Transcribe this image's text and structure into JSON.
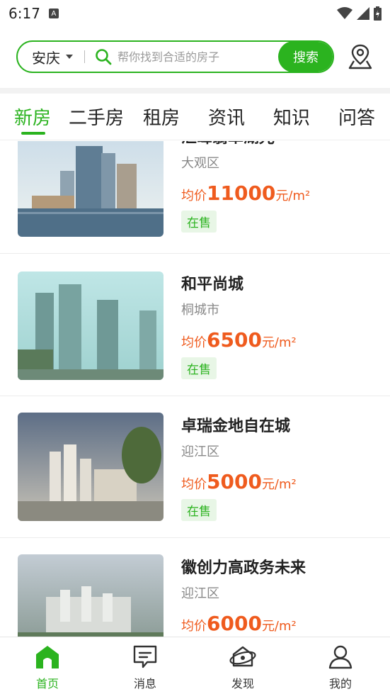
{
  "status_bar": {
    "time": "6:17"
  },
  "search": {
    "city": "安庆",
    "placeholder": "帮你找到合适的房子",
    "button_label": "搜索"
  },
  "tabs": [
    {
      "label": "新房",
      "active": true
    },
    {
      "label": "二手房"
    },
    {
      "label": "租房"
    },
    {
      "label": "资讯"
    },
    {
      "label": "知识"
    },
    {
      "label": "问答"
    }
  ],
  "listings": [
    {
      "name": "汇峰翡翠湖光",
      "district": "大观区",
      "price_label": "均价",
      "price": "11000",
      "unit": "元/m²",
      "status": "在售"
    },
    {
      "name": "和平尚城",
      "district": "桐城市",
      "price_label": "均价",
      "price": "6500",
      "unit": "元/m²",
      "status": "在售"
    },
    {
      "name": "卓瑞金地自在城",
      "district": "迎江区",
      "price_label": "均价",
      "price": "5000",
      "unit": "元/m²",
      "status": "在售"
    },
    {
      "name": "徽创力高政务未来",
      "district": "迎江区",
      "price_label": "均价",
      "price": "6000",
      "unit": "元/m²"
    }
  ],
  "bottom_nav": [
    {
      "label": "首页",
      "icon": "home-icon",
      "active": true
    },
    {
      "label": "消息",
      "icon": "message-icon"
    },
    {
      "label": "发现",
      "icon": "discover-icon"
    },
    {
      "label": "我的",
      "icon": "profile-icon"
    }
  ],
  "colors": {
    "accent": "#2bb31f",
    "price": "#ef5b1e",
    "badge_bg": "#e8f6e6"
  }
}
